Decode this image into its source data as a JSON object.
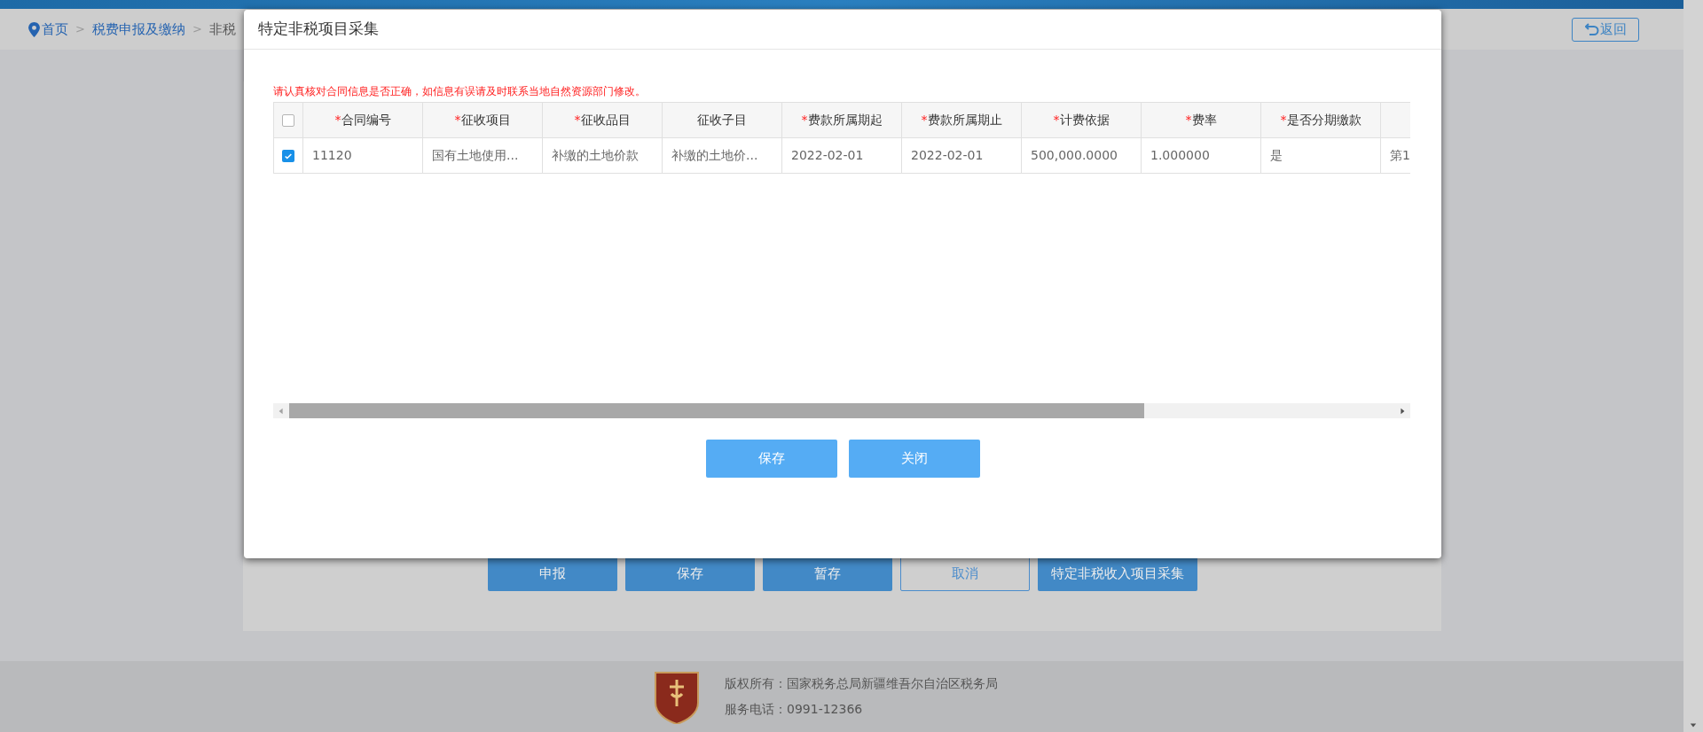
{
  "breadcrumb": [
    {
      "kind": "link",
      "label": "首页",
      "icon": true
    },
    {
      "kind": "separator",
      "label": ">"
    },
    {
      "kind": "link",
      "label": "税费申报及缴纳"
    },
    {
      "kind": "separator",
      "label": ">"
    },
    {
      "kind": "current",
      "label": "非税"
    }
  ],
  "back_button": "返回",
  "action_buttons": [
    {
      "label": "申报",
      "kind": "primary"
    },
    {
      "label": "保存",
      "kind": "primary"
    },
    {
      "label": "暂存",
      "kind": "primary"
    },
    {
      "label": "取消",
      "kind": "outline"
    },
    {
      "label": "特定非税收入项目采集",
      "kind": "primary"
    }
  ],
  "footer": {
    "copyright": "版权所有：国家税务总局新疆维吾尔自治区税务局",
    "phone": "服务电话：0991-12366"
  },
  "dialog": {
    "title": "特定非税项目采集",
    "notice": "请认真核对合同信息是否正确，如信息有误请及时联系当地自然资源部门修改。",
    "table": {
      "select_all_checked": false,
      "required_mark": "*",
      "columns": [
        {
          "label": "合同编号",
          "required": true
        },
        {
          "label": "征收项目",
          "required": true
        },
        {
          "label": "征收品目",
          "required": true
        },
        {
          "label": "征收子目",
          "required": false
        },
        {
          "label": "费款所属期起",
          "required": true
        },
        {
          "label": "费款所属期止",
          "required": true
        },
        {
          "label": "计费依据",
          "required": true
        },
        {
          "label": "费率",
          "required": true
        },
        {
          "label": "是否分期缴款",
          "required": true
        }
      ],
      "rows": [
        {
          "checked": true,
          "cells": [
            "11120",
            "国有土地使用...",
            "补缴的土地价款",
            "补缴的土地价...",
            "2022-02-01",
            "2022-02-01",
            "500,000.0000",
            "1.000000",
            "是",
            "第1"
          ]
        }
      ]
    },
    "buttons": [
      "保存",
      "关闭"
    ]
  }
}
